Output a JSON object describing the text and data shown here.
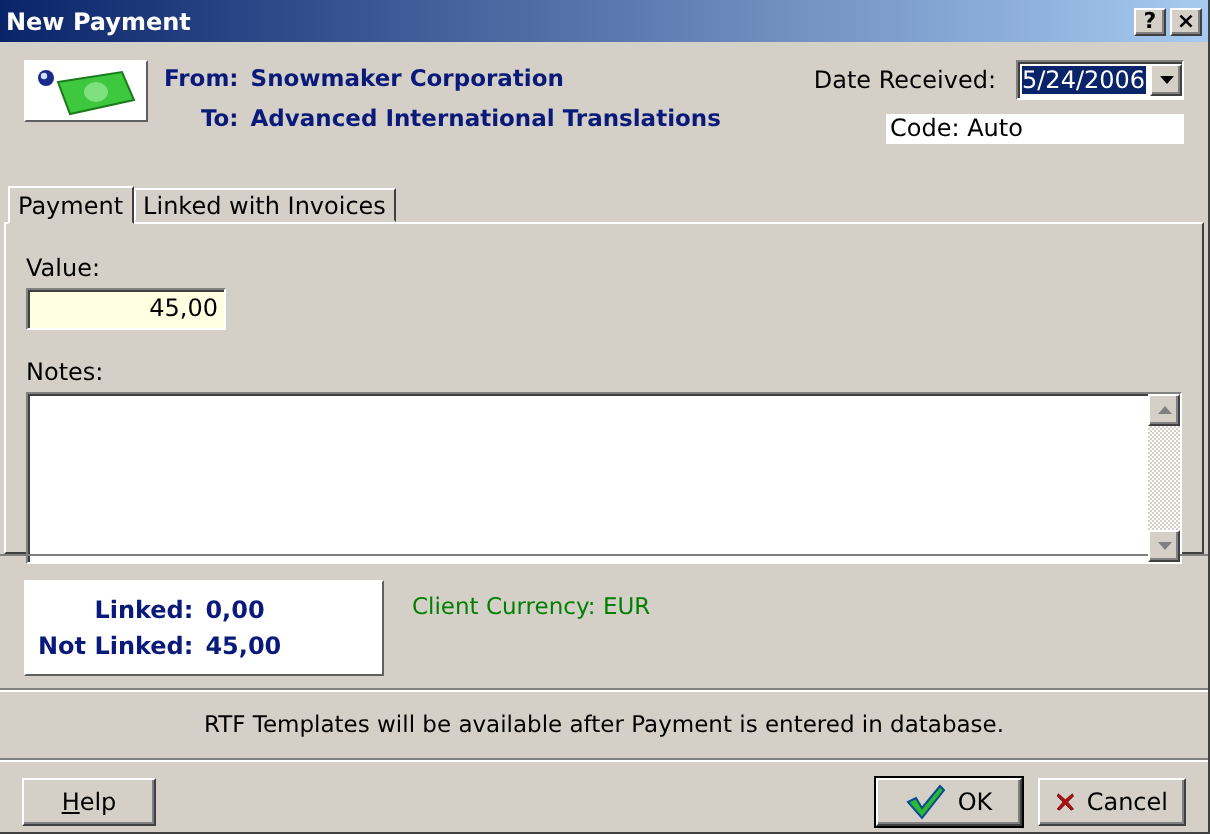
{
  "window": {
    "title": "New Payment",
    "controls": [
      "?",
      "×"
    ]
  },
  "header": {
    "from_label": "From:",
    "from": "Snowmaker Corporation",
    "to_label": "To:",
    "to": "Advanced International Translations",
    "date_label": "Date Received:",
    "date": "5/24/2006",
    "code": "Code: Auto"
  },
  "tabs": [
    {
      "label": "Payment",
      "selected": true
    },
    {
      "label": "Linked with Invoices",
      "selected": false
    }
  ],
  "payment": {
    "value_label": "Value:",
    "value": "45,00",
    "notes_label": "Notes:"
  },
  "summary": {
    "linked_label": "Linked:",
    "linked": "0,00",
    "not_linked_label": "Not Linked:",
    "not_linked": "45,00",
    "currency": "Client Currency: EUR"
  },
  "rtf_message": "RTF Templates will be available after Payment is entered in database.",
  "buttons": [
    {
      "kind": "help",
      "label": "Help"
    },
    {
      "kind": "ok",
      "label": "OK"
    },
    {
      "kind": "cancel",
      "label": "Cancel"
    }
  ]
}
